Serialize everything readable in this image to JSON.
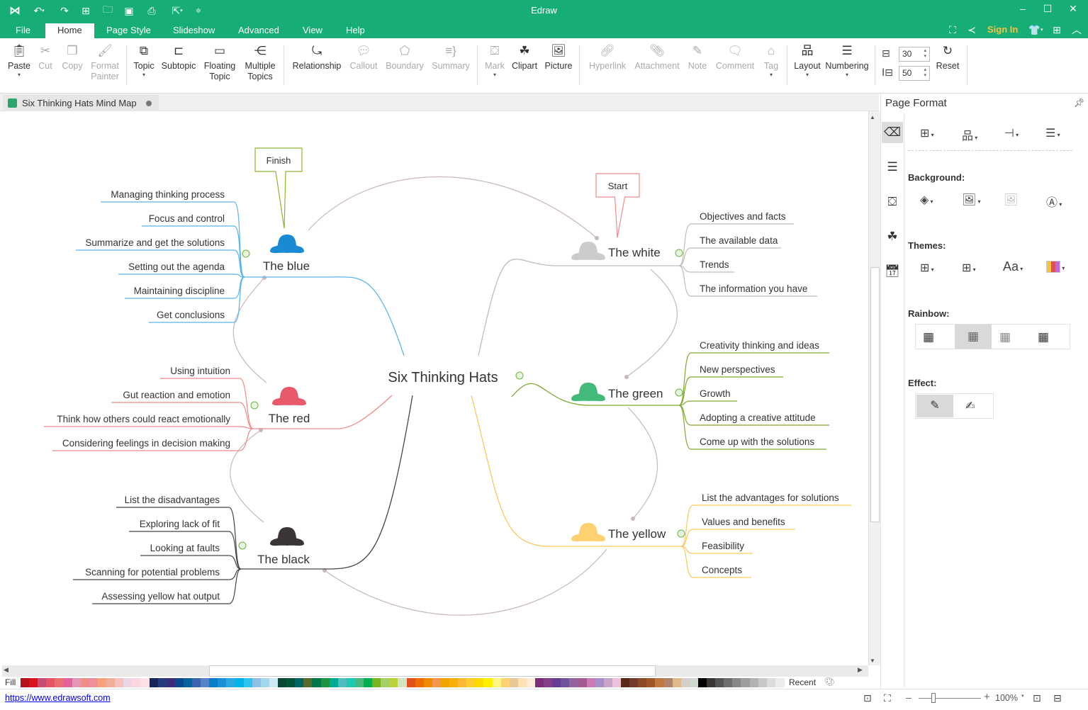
{
  "app": {
    "title": "Edraw",
    "sign_in": "Sign In"
  },
  "quick_access": [
    "logo-icon",
    "undo-icon",
    "redo-icon",
    "new-icon",
    "open-icon",
    "save-icon",
    "print-icon",
    "export-icon",
    "customize-icon"
  ],
  "menu": {
    "tabs": [
      "File",
      "Home",
      "Page Style",
      "Slideshow",
      "Advanced",
      "View",
      "Help"
    ],
    "active": "Home"
  },
  "ribbon": {
    "paste": "Paste",
    "cut": "Cut",
    "copy": "Copy",
    "format_painter_1": "Format",
    "format_painter_2": "Painter",
    "topic": "Topic",
    "subtopic": "Subtopic",
    "floating_1": "Floating",
    "floating_2": "Topic",
    "multiple_1": "Multiple",
    "multiple_2": "Topics",
    "relationship": "Relationship",
    "callout": "Callout",
    "boundary": "Boundary",
    "summary": "Summary",
    "mark": "Mark",
    "clipart": "Clipart",
    "picture": "Picture",
    "hyperlink": "Hyperlink",
    "attachment": "Attachment",
    "note": "Note",
    "comment": "Comment",
    "tag": "Tag",
    "layout": "Layout",
    "numbering": "Numbering",
    "h_spacing": "30",
    "v_spacing": "50",
    "reset": "Reset"
  },
  "document": {
    "tab_title": "Six Thinking Hats Mind Map"
  },
  "panel": {
    "title": "Page Format",
    "background_label": "Background:",
    "themes_label": "Themes:",
    "rainbow_label": "Rainbow:",
    "effect_label": "Effect:"
  },
  "mindmap": {
    "central": "Six Thinking Hats",
    "callouts": {
      "finish": "Finish",
      "start": "Start"
    },
    "hats": [
      {
        "id": "blue",
        "label": "The blue",
        "color": "#1a8ad4",
        "line": "#5ab4ea",
        "children": [
          "Managing thinking process",
          "Focus and control",
          "Summarize and get the solutions",
          "Setting out the agenda",
          "Maintaining discipline",
          "Get conclusions"
        ]
      },
      {
        "id": "white",
        "label": "The white",
        "color": "#cccccc",
        "line": "#bdbdbd",
        "children": [
          "Objectives and facts",
          "The available data",
          "Trends",
          "The information you have"
        ]
      },
      {
        "id": "green",
        "label": "The green",
        "color": "#43b97a",
        "line": "#7fa832",
        "children": [
          "Creativity thinking and ideas",
          "New perspectives",
          "Growth",
          "Adopting a creative attitude",
          "Come up with the solutions"
        ]
      },
      {
        "id": "red",
        "label": "The red",
        "color": "#e85a6b",
        "line": "#ef8a8a",
        "children": [
          "Using intuition",
          "Gut reaction and emotion",
          "Think how others could react emotionally",
          "Considering feelings in decision making"
        ]
      },
      {
        "id": "yellow",
        "label": "The yellow",
        "color": "#fdd070",
        "line": "#f9c95c",
        "children": [
          "List the advantages for solutions",
          "Values and benefits",
          "Feasibility",
          "Concepts"
        ]
      },
      {
        "id": "black",
        "label": "The black",
        "color": "#3b3535",
        "line": "#4a4444",
        "children": [
          "List the disadvantages",
          "Exploring lack of fit",
          "Looking at faults",
          "Scanning for potential problems",
          "Assessing yellow hat output"
        ]
      }
    ]
  },
  "palette": {
    "label": "Fill",
    "recent": "Recent",
    "colors": [
      "#b5121b",
      "#d7141f",
      "#c54e74",
      "#e75466",
      "#ea6f72",
      "#e4629c",
      "#e397b5",
      "#ef8e88",
      "#ef8f9b",
      "#f6a27a",
      "#f0ae98",
      "#f6c0bb",
      "#ead6e6",
      "#fbd5df",
      "#fde1e6",
      "#13275a",
      "#263c7c",
      "#3b2d79",
      "#0c4a8e",
      "#08629f",
      "#3d63b1",
      "#5484c5",
      "#0b7ecb",
      "#1c90d5",
      "#2ba8e0",
      "#00b3e8",
      "#2fc3ef",
      "#8dc0e5",
      "#a1d8ec",
      "#cde8f2",
      "#074733",
      "#025637",
      "#006664",
      "#576a2f",
      "#007849",
      "#1e9440",
      "#00ab96",
      "#4dbdc0",
      "#1dc9af",
      "#45b880",
      "#00b050",
      "#7ab51d",
      "#a3cf66",
      "#bcd23b",
      "#d2e6c6",
      "#e0511e",
      "#ec6e05",
      "#f08a00",
      "#f4964b",
      "#f1a300",
      "#fbae05",
      "#fdb934",
      "#fdcd31",
      "#ffda00",
      "#fff000",
      "#fff581",
      "#fdd272",
      "#e8c897",
      "#fee1b5",
      "#fdecd9",
      "#7d2d7a",
      "#853f87",
      "#643f91",
      "#71539b",
      "#95629e",
      "#a25b8e",
      "#cb7ab5",
      "#a690c8",
      "#c8a6c9",
      "#ebc1dc",
      "#5a2719",
      "#753a2f",
      "#8d4a28",
      "#a0552a",
      "#c07740",
      "#b0846c",
      "#e0b98b",
      "#d4cfc8",
      "#cfd8cf",
      "#000000",
      "#3a3637",
      "#545454",
      "#6e6e6e",
      "#878787",
      "#9d9d9d",
      "#b2b2b2",
      "#c8c8c8",
      "#dcdcdc",
      "#ececec"
    ]
  },
  "status": {
    "url": "https://www.edrawsoft.com",
    "zoom": "100%"
  }
}
